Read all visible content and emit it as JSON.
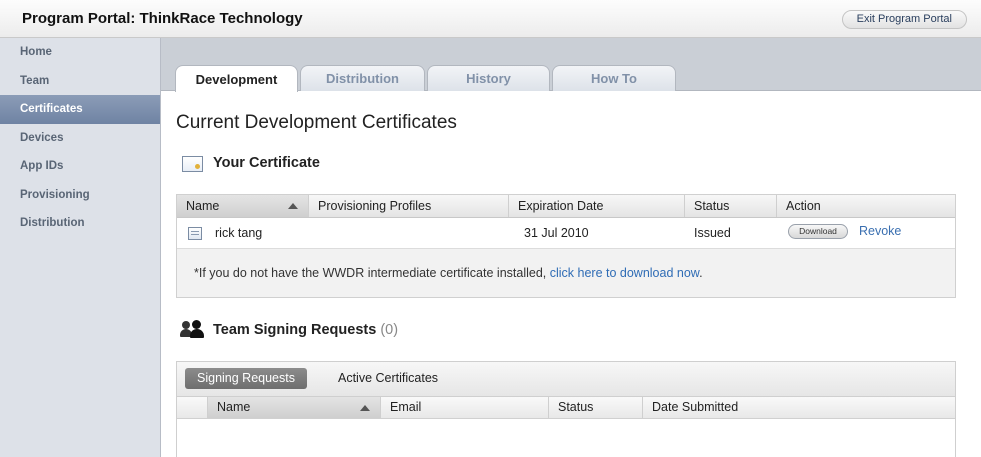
{
  "header": {
    "title": "Program Portal: ThinkRace Technology",
    "exit_label": "Exit Program Portal"
  },
  "sidebar": {
    "items": [
      {
        "label": "Home"
      },
      {
        "label": "Team"
      },
      {
        "label": "Certificates",
        "active": true
      },
      {
        "label": "Devices"
      },
      {
        "label": "App IDs"
      },
      {
        "label": "Provisioning"
      },
      {
        "label": "Distribution"
      }
    ]
  },
  "tabs": [
    {
      "label": "Development",
      "active": true
    },
    {
      "label": "Distribution"
    },
    {
      "label": "History"
    },
    {
      "label": "How To"
    }
  ],
  "page_title": "Current Development Certificates",
  "your_certificate": {
    "title": "Your Certificate",
    "columns": [
      "Name",
      "Provisioning Profiles",
      "Expiration Date",
      "Status",
      "Action"
    ],
    "rows": [
      {
        "name": "rick tang",
        "profiles": "",
        "expiration": "31 Jul 2010",
        "status": "Issued",
        "download_label": "Download",
        "revoke_label": "Revoke"
      }
    ],
    "note_text": "*If you do not have the WWDR intermediate certificate installed, ",
    "note_link": "click here to download now",
    "note_end": "."
  },
  "team_signing": {
    "title": "Team Signing Requests",
    "count": "(0)",
    "subtabs": [
      "Signing Requests",
      "Active Certificates"
    ],
    "columns": [
      "Name",
      "Email",
      "Status",
      "Date Submitted"
    ]
  },
  "colors": {
    "sidebar_active": "#7a8dac",
    "link": "#2f6cb5",
    "sidebar_bg": "#dde1e8"
  },
  "icons": [
    "certificate-icon",
    "team-icon",
    "sort-ascending-icon"
  ]
}
